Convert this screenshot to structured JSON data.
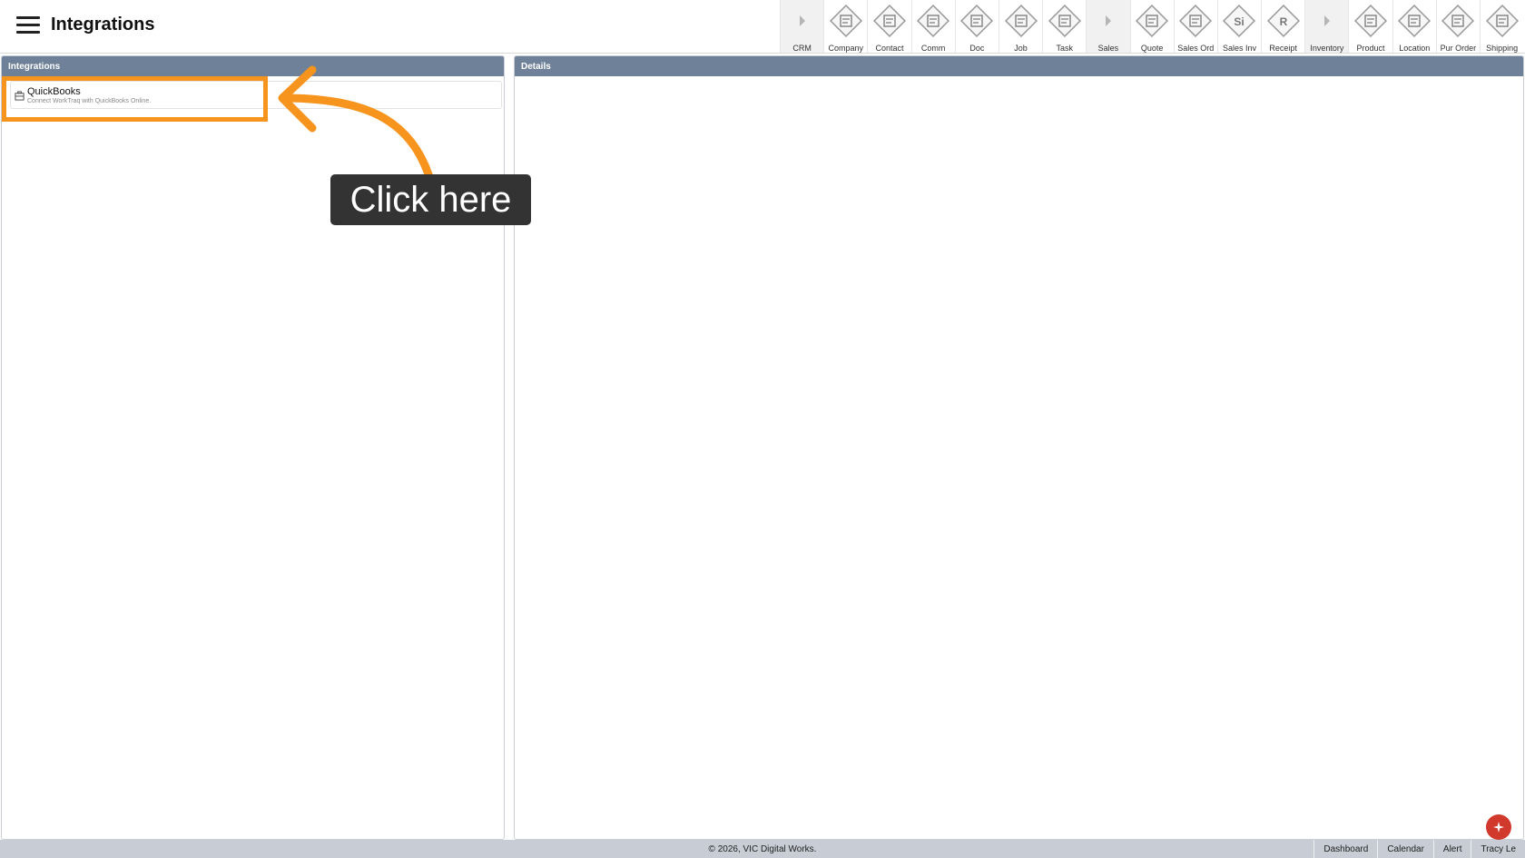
{
  "header": {
    "title": "Integrations"
  },
  "modules": [
    {
      "label": "CRM",
      "icon": "chevron-right-icon",
      "group": true
    },
    {
      "label": "Company",
      "icon": "company-icon",
      "group": false
    },
    {
      "label": "Contact",
      "icon": "contact-icon",
      "group": false
    },
    {
      "label": "Comm",
      "icon": "comm-icon",
      "group": false
    },
    {
      "label": "Doc",
      "icon": "doc-icon",
      "group": false
    },
    {
      "label": "Job",
      "icon": "job-icon",
      "group": false
    },
    {
      "label": "Task",
      "icon": "task-icon",
      "group": false
    },
    {
      "label": "Sales",
      "icon": "chevron-right-icon",
      "group": true
    },
    {
      "label": "Quote",
      "icon": "quote-icon",
      "group": false
    },
    {
      "label": "Sales Ord",
      "icon": "sales-order-icon",
      "group": false
    },
    {
      "label": "Sales Inv",
      "icon": "sales-invoice-icon",
      "group": false,
      "glyph": "Si"
    },
    {
      "label": "Receipt",
      "icon": "receipt-icon",
      "group": false,
      "glyph": "R"
    },
    {
      "label": "Inventory",
      "icon": "chevron-right-icon",
      "group": true
    },
    {
      "label": "Product",
      "icon": "product-icon",
      "group": false
    },
    {
      "label": "Location",
      "icon": "location-icon",
      "group": false
    },
    {
      "label": "Pur Order",
      "icon": "purchase-order-icon",
      "group": false
    },
    {
      "label": "Shipping",
      "icon": "shipping-icon",
      "group": false
    }
  ],
  "integrations_panel": {
    "title": "Integrations",
    "items": [
      {
        "name": "QuickBooks",
        "description": "Connect WorkTraq with QuickBooks Online."
      }
    ]
  },
  "details_panel": {
    "title": "Details"
  },
  "callout": {
    "text": "Click here",
    "color": "#f7941d"
  },
  "footer": {
    "copyright": "© 2026, VIC Digital Works.",
    "links": [
      "Dashboard",
      "Calendar",
      "Alert",
      "Tracy Le"
    ]
  },
  "colors": {
    "panel_header": "#6f8198",
    "footer_bg": "#c7ccd5",
    "fab": "#d0392c",
    "highlight": "#f7941d"
  }
}
